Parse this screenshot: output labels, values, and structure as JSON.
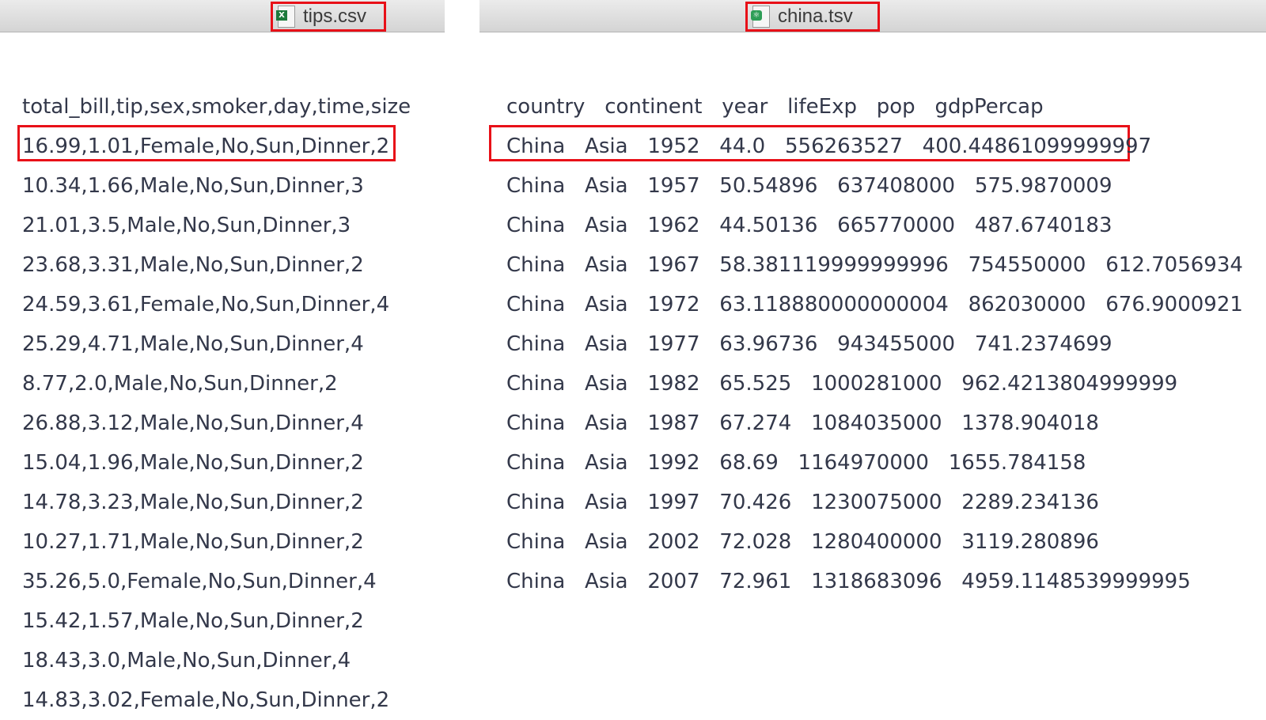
{
  "left": {
    "filename": "tips.csv",
    "icon": "excel-file-icon",
    "lines": [
      "total_bill,tip,sex,smoker,day,time,size",
      "16.99,1.01,Female,No,Sun,Dinner,2",
      "10.34,1.66,Male,No,Sun,Dinner,3",
      "21.01,3.5,Male,No,Sun,Dinner,3",
      "23.68,3.31,Male,No,Sun,Dinner,2",
      "24.59,3.61,Female,No,Sun,Dinner,4",
      "25.29,4.71,Male,No,Sun,Dinner,4",
      "8.77,2.0,Male,No,Sun,Dinner,2",
      "26.88,3.12,Male,No,Sun,Dinner,4",
      "15.04,1.96,Male,No,Sun,Dinner,2",
      "14.78,3.23,Male,No,Sun,Dinner,2",
      "10.27,1.71,Male,No,Sun,Dinner,2",
      "35.26,5.0,Female,No,Sun,Dinner,4",
      "15.42,1.57,Male,No,Sun,Dinner,2",
      "18.43,3.0,Male,No,Sun,Dinner,4",
      "14.83,3.02,Female,No,Sun,Dinner,2"
    ]
  },
  "right": {
    "filename": "china.tsv",
    "icon": "atom-file-icon",
    "lines": [
      "country   continent   year   lifeExp   pop   gdpPercap",
      "China   Asia   1952   44.0   556263527   400.44861099999997",
      "China   Asia   1957   50.54896   637408000   575.9870009",
      "China   Asia   1962   44.50136   665770000   487.6740183",
      "China   Asia   1967   58.381119999999996   754550000   612.7056934",
      "China   Asia   1972   63.118880000000004   862030000   676.9000921",
      "China   Asia   1977   63.96736   943455000   741.2374699",
      "China   Asia   1982   65.525   1000281000   962.4213804999999",
      "China   Asia   1987   67.274   1084035000   1378.904018",
      "China   Asia   1992   68.69   1164970000   1655.784158",
      "China   Asia   1997   70.426   1230075000   2289.234136",
      "China   Asia   2002   72.028   1280400000   3119.280896",
      "China   Asia   2007   72.961   1318683096   4959.1148539999995"
    ]
  },
  "colors": {
    "highlight": "#e81018",
    "text": "#33384a",
    "titlebar": "#dcdcdc"
  }
}
